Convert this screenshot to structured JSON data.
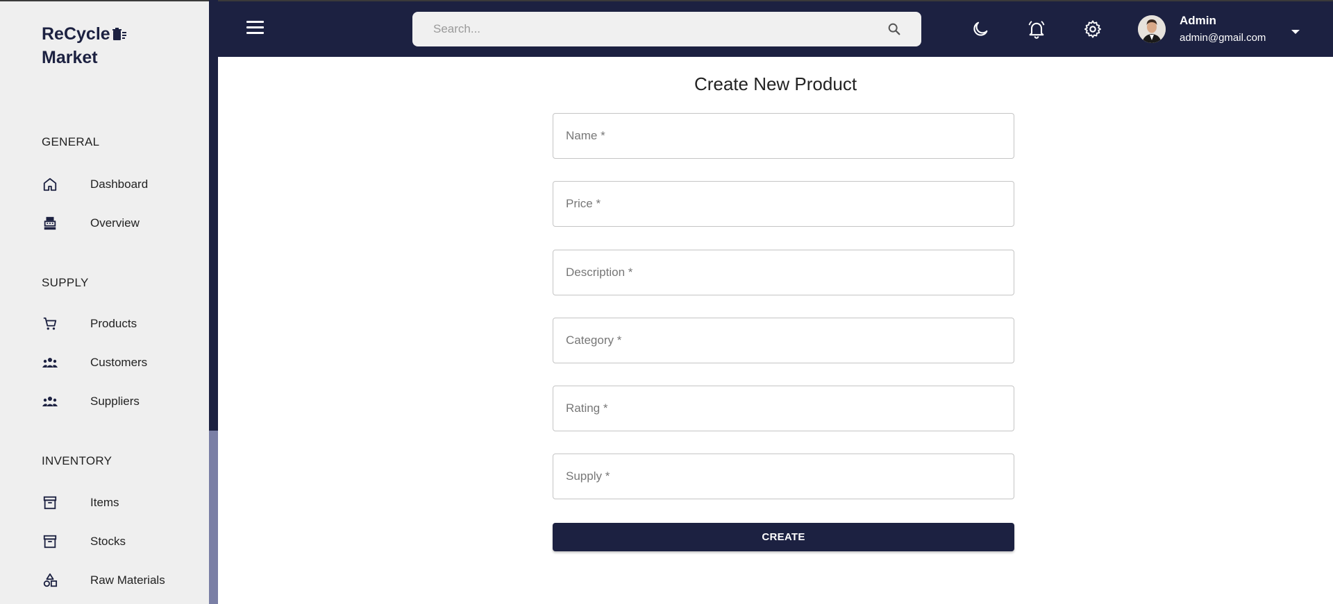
{
  "app": {
    "brand_line1": "ReCycle",
    "brand_line2": "Market"
  },
  "sidebar": {
    "sections": [
      {
        "title": "GENERAL",
        "items": [
          {
            "label": "Dashboard",
            "icon": "home-icon"
          },
          {
            "label": "Overview",
            "icon": "cash-register-icon"
          }
        ]
      },
      {
        "title": "SUPPLY",
        "items": [
          {
            "label": "Products",
            "icon": "shopping-cart-icon"
          },
          {
            "label": "Customers",
            "icon": "groups-icon"
          },
          {
            "label": "Suppliers",
            "icon": "groups-icon"
          }
        ]
      },
      {
        "title": "INVENTORY",
        "items": [
          {
            "label": "Items",
            "icon": "archive-icon"
          },
          {
            "label": "Stocks",
            "icon": "archive-icon"
          },
          {
            "label": "Raw Materials",
            "icon": "shapes-icon"
          }
        ]
      }
    ]
  },
  "header": {
    "search_placeholder": "Search...",
    "user": {
      "name": "Admin",
      "email": "admin@gmail.com"
    }
  },
  "form": {
    "title": "Create New Product",
    "fields": [
      {
        "placeholder": "Name *",
        "value": ""
      },
      {
        "placeholder": "Price *",
        "value": ""
      },
      {
        "placeholder": "Description *",
        "value": ""
      },
      {
        "placeholder": "Category *",
        "value": ""
      },
      {
        "placeholder": "Rating *",
        "value": ""
      },
      {
        "placeholder": "Supply *",
        "value": ""
      }
    ],
    "submit_label": "CREATE"
  },
  "colors": {
    "primary": "#1c2141",
    "sidebar_bg": "#efefef",
    "search_bg": "#f0f0f0"
  }
}
